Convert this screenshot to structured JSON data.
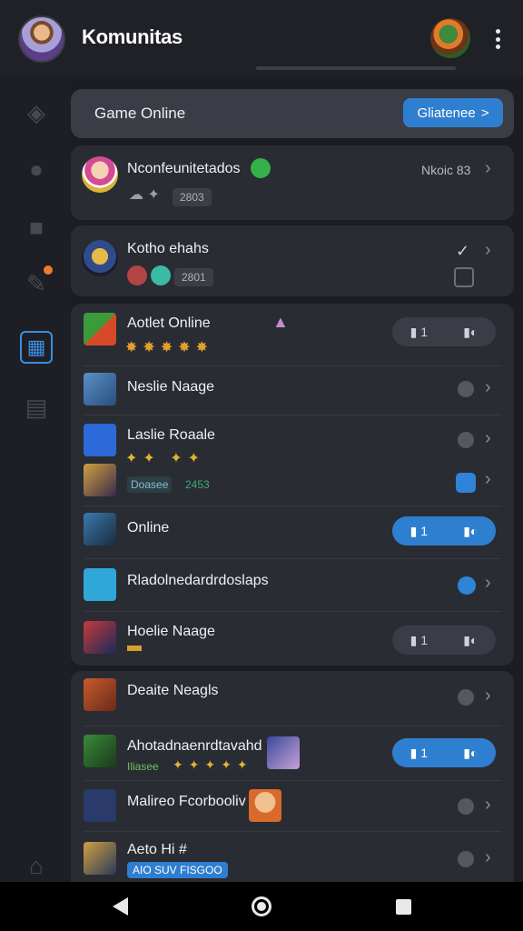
{
  "header": {
    "title": "Komunitas"
  },
  "banner": {
    "title": "Game Online",
    "button_label": "Gliatenee",
    "button_chevron": ">"
  },
  "featured": [
    {
      "title": "Nconfeunitetados",
      "meta": "Nkoic 83",
      "chip": "2803"
    },
    {
      "title": "Kotho ehahs",
      "meta": "✓",
      "chip": "2801"
    }
  ],
  "list1": [
    {
      "title": "Aotlet Online",
      "vote_count": "1"
    },
    {
      "title": "Neslie Naage"
    },
    {
      "title": "Laslie Roaale",
      "sub_chip": "Doasee",
      "sub_value": "2453"
    },
    {
      "title": "Online",
      "vote_count": "1"
    },
    {
      "title": "Rladolnedardrdoslaps"
    },
    {
      "title": "Hoelie Naage",
      "vote_count": "1"
    }
  ],
  "list2": [
    {
      "title": "Deaite Neagls"
    },
    {
      "title": "Ahotadnaenrdtavahd",
      "sub": "Iliasee",
      "vote_count": "1"
    },
    {
      "title": "Malireo Fcorbooliv"
    },
    {
      "title": "Aeto Hi #",
      "sub_chip": "AIO SUV FISGOO"
    }
  ],
  "icons": {
    "chevron": "›",
    "vote_left": "👍",
    "vote_right": "👎"
  },
  "colors": {
    "accent": "#2f7fd0",
    "card": "#2a2c33",
    "background": "#1b1d22"
  }
}
